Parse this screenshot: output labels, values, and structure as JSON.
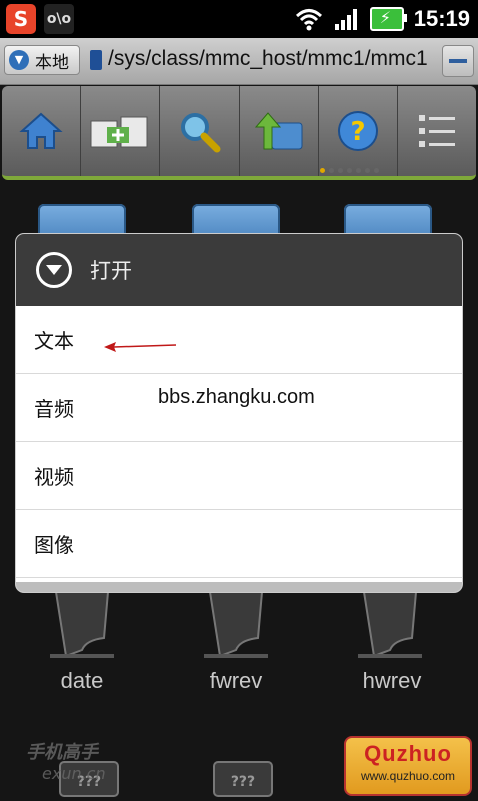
{
  "status_bar": {
    "app_icon_letter": "S",
    "cat_icon_text": "o\\o",
    "time": "15:19",
    "battery_color": "#3bbf3b"
  },
  "path_bar": {
    "location_label": "本地",
    "path": "/sys/class/mmc_host/mmc1/mmc1"
  },
  "toolbar": {
    "tools": [
      "home-icon",
      "new-folder-icon",
      "search-icon",
      "up-folder-icon",
      "help-icon",
      "list-view-icon"
    ],
    "page_count": 7,
    "current_page": 1
  },
  "files": {
    "names": [
      "date",
      "fwrev",
      "hwrev"
    ],
    "placeholder_text": "???"
  },
  "dialog": {
    "title": "打开",
    "items": [
      {
        "label": "文本"
      },
      {
        "label": "音频"
      },
      {
        "label": "视频"
      },
      {
        "label": "图像"
      }
    ]
  },
  "overlay_text": "bbs.zhangku.com",
  "watermarks": {
    "left_cn": "手机高手",
    "left_en": "exun.cn",
    "right_brand": "Quzhuo",
    "right_url": "www.quzhuo.com"
  },
  "colors": {
    "accent_green": "#7fa93a",
    "dialog_header": "#3b3b3b",
    "arrow_red": "#c01818"
  }
}
